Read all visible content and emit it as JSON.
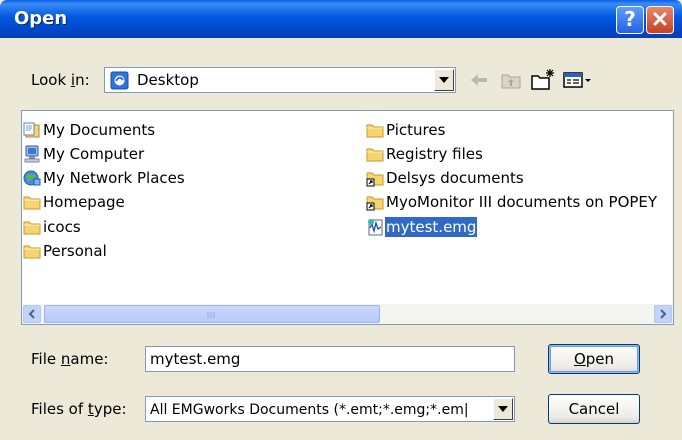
{
  "window": {
    "title": "Open",
    "help_glyph": "?"
  },
  "look_in": {
    "label_pre": "Look ",
    "label_key": "i",
    "label_post": "n:",
    "value": "Desktop",
    "value_icon": "desktop-icon"
  },
  "toolbar": {
    "icons": [
      "back-arrow-icon",
      "up-folder-icon",
      "new-folder-icon",
      "view-menu-icon"
    ]
  },
  "files": [
    {
      "name": "My Documents",
      "icon": "my-documents-icon",
      "selected": false
    },
    {
      "name": "My Computer",
      "icon": "computer-icon",
      "selected": false
    },
    {
      "name": "My Network Places",
      "icon": "network-places-icon",
      "selected": false
    },
    {
      "name": "Homepage",
      "icon": "folder-icon",
      "selected": false
    },
    {
      "name": "icocs",
      "icon": "folder-icon",
      "selected": false
    },
    {
      "name": "Personal",
      "icon": "folder-icon",
      "selected": false
    },
    {
      "name": "Pictures",
      "icon": "folder-icon",
      "selected": false
    },
    {
      "name": "Registry files",
      "icon": "folder-icon",
      "selected": false
    },
    {
      "name": "Delsys documents",
      "icon": "folder-shortcut-icon",
      "selected": false
    },
    {
      "name": "MyoMonitor III documents on POPEY",
      "icon": "folder-shortcut-icon",
      "selected": false
    },
    {
      "name": "mytest.emg",
      "icon": "emg-file-icon",
      "selected": true
    }
  ],
  "file_name": {
    "label_pre": "File ",
    "label_key": "n",
    "label_post": "ame:",
    "value": "mytest.emg"
  },
  "file_type": {
    "label_pre": "Files of ",
    "label_key": "t",
    "label_post": "ype:",
    "value": "All EMGworks Documents (*.emt;*.emg;*.em|"
  },
  "buttons": {
    "open_key": "O",
    "open_rest": "pen",
    "cancel": "Cancel"
  },
  "colors": {
    "title_bar": "#0054e3",
    "selection": "#316ac5",
    "dialog_bg": "#ece9d8"
  }
}
